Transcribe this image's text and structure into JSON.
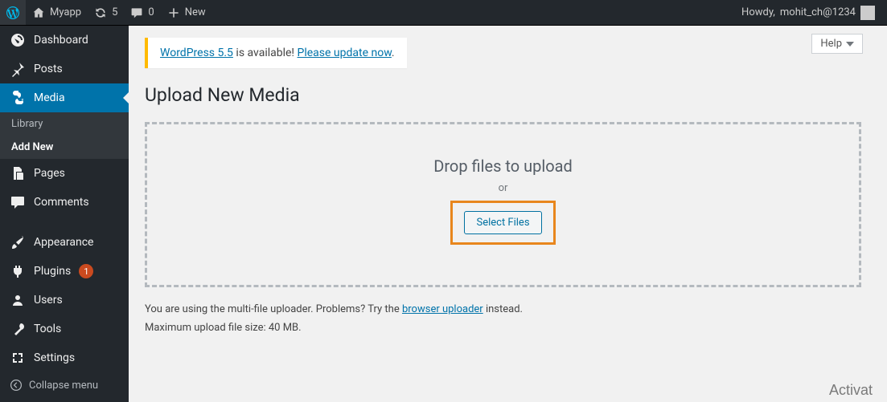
{
  "toolbar": {
    "site_name": "Myapp",
    "update_count": "5",
    "comment_count": "0",
    "new_label": "New",
    "howdy_prefix": "Howdy,",
    "user": "mohit_ch@1234"
  },
  "sidebar": {
    "items": [
      {
        "label": "Dashboard"
      },
      {
        "label": "Posts"
      },
      {
        "label": "Media"
      },
      {
        "label": "Pages"
      },
      {
        "label": "Comments"
      },
      {
        "label": "Appearance"
      },
      {
        "label": "Plugins",
        "badge": "1"
      },
      {
        "label": "Users"
      },
      {
        "label": "Tools"
      },
      {
        "label": "Settings"
      }
    ],
    "submenu": {
      "library": "Library",
      "add_new": "Add New"
    },
    "collapse": "Collapse menu"
  },
  "content": {
    "help": "Help",
    "notice": {
      "link1": "WordPress 5.5",
      "mid": " is available! ",
      "link2": "Please update now",
      "tail": "."
    },
    "heading": "Upload New Media",
    "drop_hint": "Drop files to upload",
    "or": "or",
    "select_files": "Select Files",
    "uploader_info_pre": "You are using the multi-file uploader. Problems? Try the ",
    "uploader_info_link": "browser uploader",
    "uploader_info_post": " instead.",
    "max_size": "Maximum upload file size: 40 MB.",
    "watermark": "Activat"
  }
}
